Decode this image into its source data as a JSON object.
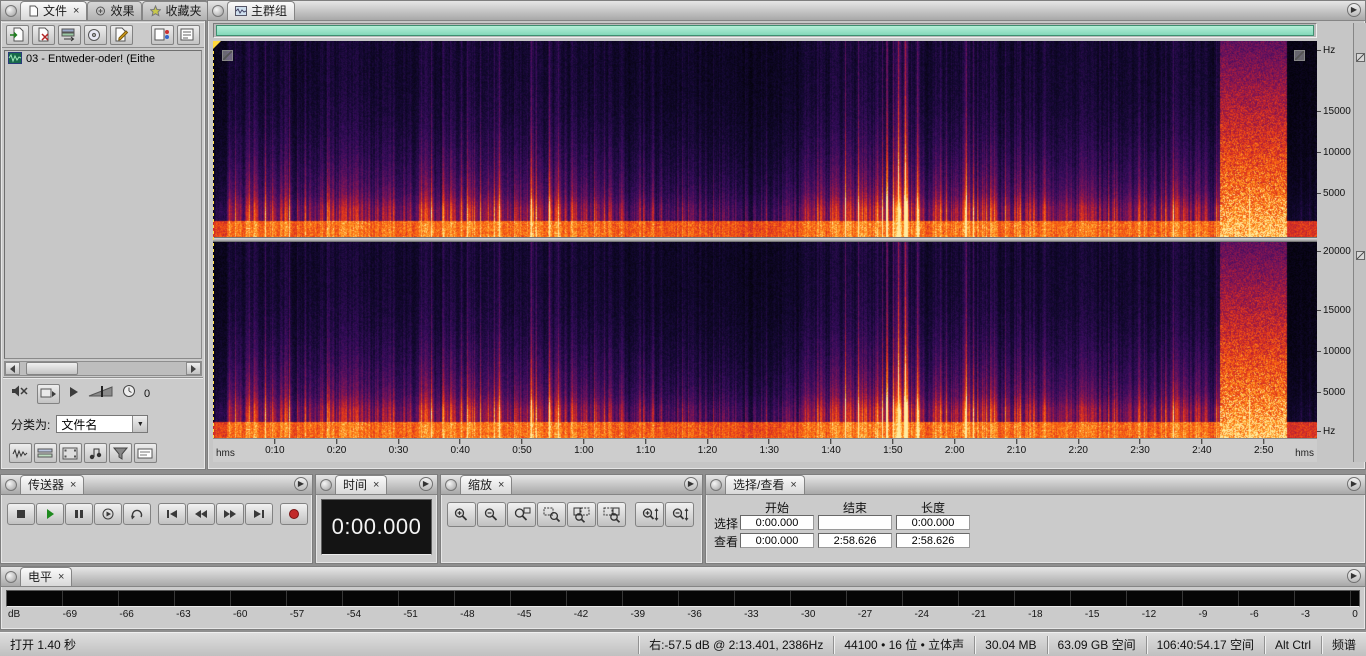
{
  "glyphs": {
    "close": "×",
    "menu": "▶",
    "dropdown": "▼"
  },
  "files_panel": {
    "tabs": [
      {
        "label": "文件"
      },
      {
        "label": "效果"
      },
      {
        "label": "收藏夹"
      }
    ],
    "file_list": [
      {
        "name": "03 - Entweder-oder! (Eithe"
      }
    ],
    "sort_label": "分类为:",
    "sort_value": "文件名",
    "preview_volume": "0"
  },
  "main_group": {
    "tab": "主群组",
    "freq_labels_top": [
      "Hz",
      "15000",
      "10000",
      "5000"
    ],
    "freq_labels_bottom": [
      "20000",
      "15000",
      "10000",
      "5000",
      "Hz"
    ],
    "timeline": {
      "unit_left": "hms",
      "unit_right": "hms",
      "duration_seconds": 178.626,
      "ticks": [
        "0:10",
        "0:20",
        "0:30",
        "0:40",
        "0:50",
        "1:00",
        "1:10",
        "1:20",
        "1:30",
        "1:40",
        "1:50",
        "2:00",
        "2:10",
        "2:20",
        "2:30",
        "2:40",
        "2:50"
      ]
    }
  },
  "transport_panel": {
    "title": "传送器"
  },
  "time_panel": {
    "title": "时间",
    "value": "0:00.000"
  },
  "zoom_panel": {
    "title": "缩放"
  },
  "selection_panel": {
    "title": "选择/查看",
    "headers": [
      "开始",
      "结束",
      "长度"
    ],
    "rows": [
      {
        "label": "选择",
        "start": "0:00.000",
        "end": "",
        "length": "0:00.000"
      },
      {
        "label": "查看",
        "start": "0:00.000",
        "end": "2:58.626",
        "length": "2:58.626"
      }
    ]
  },
  "levels_panel": {
    "title": "电平",
    "scale": [
      "dB",
      "-69",
      "-66",
      "-63",
      "-60",
      "-57",
      "-54",
      "-51",
      "-48",
      "-45",
      "-42",
      "-39",
      "-36",
      "-33",
      "-30",
      "-27",
      "-24",
      "-21",
      "-18",
      "-15",
      "-12",
      "-9",
      "-6",
      "-3",
      "0"
    ]
  },
  "status_bar": {
    "left": "打开 1.40 秒",
    "segments": [
      "右:-57.5 dB @  2:13.401, 2386Hz",
      "44100 • 16 位 • 立体声",
      "30.04 MB",
      "63.09 GB 空间",
      "106:40:54.17 空间",
      "Alt Ctrl",
      "频谱"
    ]
  }
}
